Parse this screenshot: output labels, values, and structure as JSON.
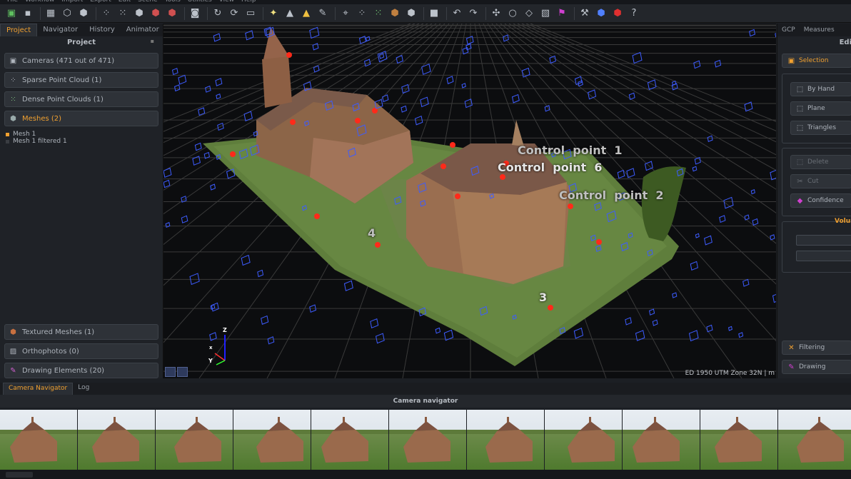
{
  "menubar": {
    "items": [
      "File",
      "Workflow",
      "Import",
      "Export",
      "Edit",
      "Scene",
      "Tools",
      "Utilities",
      "View",
      "Help"
    ]
  },
  "toolbar": {
    "icons": [
      "new-project-icon",
      "save-icon",
      "sep",
      "grid-icon",
      "box-icon",
      "cube-icon",
      "sep",
      "sparse-icon",
      "dense-icon",
      "mesh-icon",
      "texture-icon",
      "ortho-icon",
      "sep",
      "camera-icon",
      "sep",
      "rotate-icon",
      "orbit-icon",
      "fit-icon",
      "sep",
      "light-icon",
      "shading-icon",
      "color-icon",
      "brush-icon",
      "sep",
      "select-icon",
      "points-icon",
      "lasso-icon",
      "cube-small-icon",
      "box-small-icon",
      "sep",
      "stop-icon",
      "sep",
      "undo-icon",
      "redo-icon",
      "sep",
      "tool-icon",
      "circle-icon",
      "plane-icon",
      "hatch-icon",
      "flag-icon",
      "sep",
      "wrench-icon",
      "view-cube-icon",
      "red-cube-icon",
      "help-icon"
    ]
  },
  "left_panel": {
    "tabs": [
      {
        "label": "Project",
        "active": true
      },
      {
        "label": "Navigator",
        "active": false
      },
      {
        "label": "History",
        "active": false
      },
      {
        "label": "Animator",
        "active": false
      }
    ],
    "title": "Project",
    "groups": [
      {
        "label": "Cameras (471 out of 471)",
        "icon": "camera-icon",
        "active": false
      },
      {
        "label": "Sparse Point Cloud (1)",
        "icon": "sparse-cloud-icon",
        "active": false
      },
      {
        "label": "Dense Point Clouds (1)",
        "icon": "dense-cloud-icon",
        "active": false
      },
      {
        "label": "Meshes (2)",
        "icon": "mesh-icon",
        "active": true
      }
    ],
    "meshes": [
      {
        "label": "Mesh 1",
        "color": "#f0a030"
      },
      {
        "label": "Mesh 1 filtered 1",
        "color": "#3a3d42"
      }
    ],
    "bottom_groups": [
      {
        "label": "Textured Meshes (1)",
        "icon": "textured-mesh-icon"
      },
      {
        "label": "Orthophotos (0)",
        "icon": "orthophoto-icon"
      },
      {
        "label": "Drawing Elements (20)",
        "icon": "drawing-icon"
      }
    ]
  },
  "viewport": {
    "control_points": [
      {
        "label": "Control  point  1"
      },
      {
        "label": "Control  point  6"
      },
      {
        "label": "Control  point  2"
      },
      {
        "label": "4"
      },
      {
        "label": "3"
      }
    ],
    "axes": {
      "z": "Z",
      "x": "x",
      "y": "Y"
    },
    "coord_system": "ED 1950 UTM Zone 32N | m"
  },
  "right_panel": {
    "tabs": [
      "GCP",
      "Measures"
    ],
    "title": "Edi",
    "selection_label": "Selection",
    "buttons": [
      {
        "label": "By Hand",
        "icon": "hand-select-icon"
      },
      {
        "label": "Plane",
        "icon": "plane-select-icon"
      },
      {
        "label": "Triangles",
        "icon": "triangles-icon"
      },
      {
        "label": "Delete",
        "icon": "delete-icon"
      },
      {
        "label": "Cut",
        "icon": "cut-icon"
      },
      {
        "label": "Confidence",
        "icon": "confidence-icon"
      }
    ],
    "volume_label": "Volun",
    "filtering_label": "Filtering",
    "drawing_label": "Drawing"
  },
  "bottom": {
    "tabs": [
      {
        "label": "Camera Navigator",
        "active": true
      },
      {
        "label": "Log",
        "active": false
      }
    ],
    "title": "Camera navigator",
    "thumbnail_count": 11
  }
}
